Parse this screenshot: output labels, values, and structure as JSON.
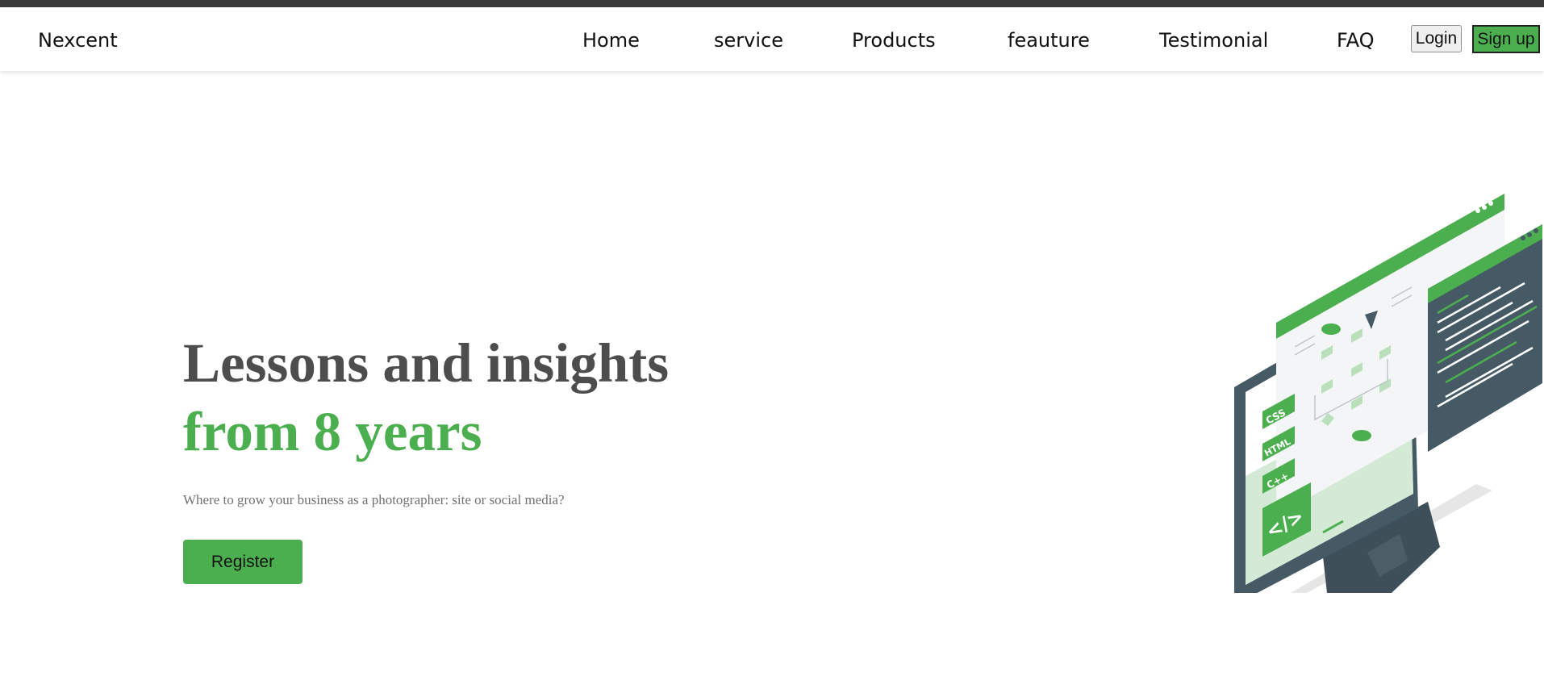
{
  "colors": {
    "accent": "#4caf4f",
    "heading": "#4d4d4d",
    "dark_bar": "#3a3a3a"
  },
  "header": {
    "brand": "Nexcent",
    "nav": [
      "Home",
      "service",
      "Products",
      "feauture",
      "Testimonial",
      "FAQ"
    ],
    "login_label": "Login",
    "signup_label": "Sign up"
  },
  "hero": {
    "title_line1": "Lessons and insights",
    "title_line2": "from 8 years",
    "subtitle": "Where to grow your business as a photographer: site or social media?",
    "register_label": "Register"
  },
  "illustration": {
    "icon": "monitor-code-illustration",
    "badges": [
      "CSS",
      "HTML",
      "C++",
      "</>"
    ]
  }
}
